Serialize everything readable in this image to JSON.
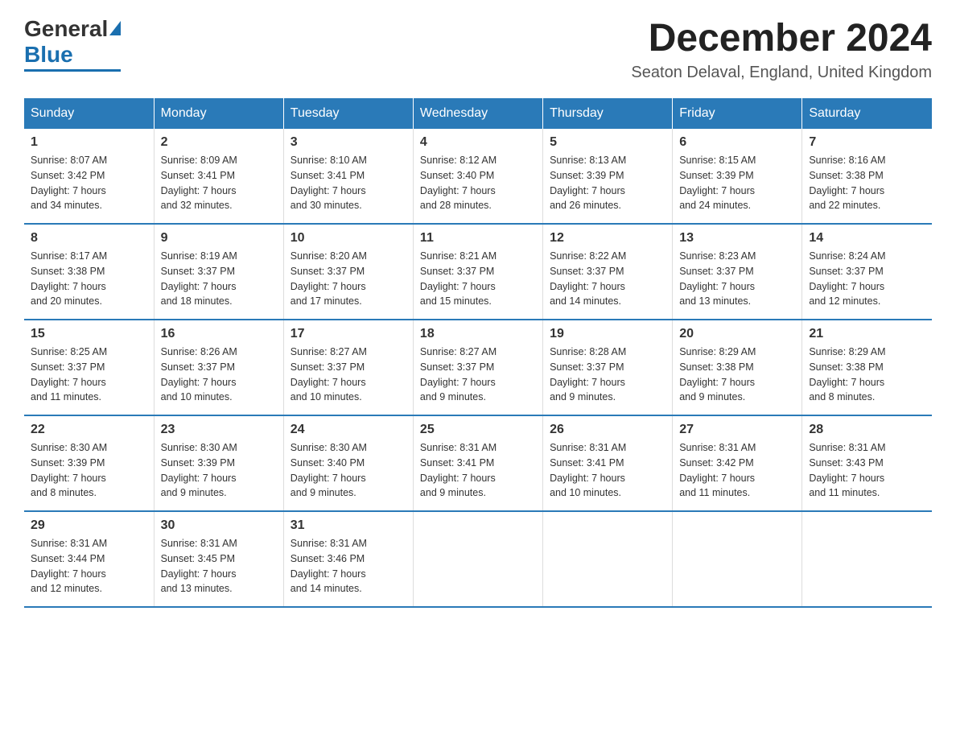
{
  "logo": {
    "general": "General",
    "blue": "Blue"
  },
  "header": {
    "month_title": "December 2024",
    "location": "Seaton Delaval, England, United Kingdom"
  },
  "weekdays": [
    "Sunday",
    "Monday",
    "Tuesday",
    "Wednesday",
    "Thursday",
    "Friday",
    "Saturday"
  ],
  "weeks": [
    [
      {
        "day": "1",
        "sunrise": "8:07 AM",
        "sunset": "3:42 PM",
        "daylight": "7 hours and 34 minutes."
      },
      {
        "day": "2",
        "sunrise": "8:09 AM",
        "sunset": "3:41 PM",
        "daylight": "7 hours and 32 minutes."
      },
      {
        "day": "3",
        "sunrise": "8:10 AM",
        "sunset": "3:41 PM",
        "daylight": "7 hours and 30 minutes."
      },
      {
        "day": "4",
        "sunrise": "8:12 AM",
        "sunset": "3:40 PM",
        "daylight": "7 hours and 28 minutes."
      },
      {
        "day": "5",
        "sunrise": "8:13 AM",
        "sunset": "3:39 PM",
        "daylight": "7 hours and 26 minutes."
      },
      {
        "day": "6",
        "sunrise": "8:15 AM",
        "sunset": "3:39 PM",
        "daylight": "7 hours and 24 minutes."
      },
      {
        "day": "7",
        "sunrise": "8:16 AM",
        "sunset": "3:38 PM",
        "daylight": "7 hours and 22 minutes."
      }
    ],
    [
      {
        "day": "8",
        "sunrise": "8:17 AM",
        "sunset": "3:38 PM",
        "daylight": "7 hours and 20 minutes."
      },
      {
        "day": "9",
        "sunrise": "8:19 AM",
        "sunset": "3:37 PM",
        "daylight": "7 hours and 18 minutes."
      },
      {
        "day": "10",
        "sunrise": "8:20 AM",
        "sunset": "3:37 PM",
        "daylight": "7 hours and 17 minutes."
      },
      {
        "day": "11",
        "sunrise": "8:21 AM",
        "sunset": "3:37 PM",
        "daylight": "7 hours and 15 minutes."
      },
      {
        "day": "12",
        "sunrise": "8:22 AM",
        "sunset": "3:37 PM",
        "daylight": "7 hours and 14 minutes."
      },
      {
        "day": "13",
        "sunrise": "8:23 AM",
        "sunset": "3:37 PM",
        "daylight": "7 hours and 13 minutes."
      },
      {
        "day": "14",
        "sunrise": "8:24 AM",
        "sunset": "3:37 PM",
        "daylight": "7 hours and 12 minutes."
      }
    ],
    [
      {
        "day": "15",
        "sunrise": "8:25 AM",
        "sunset": "3:37 PM",
        "daylight": "7 hours and 11 minutes."
      },
      {
        "day": "16",
        "sunrise": "8:26 AM",
        "sunset": "3:37 PM",
        "daylight": "7 hours and 10 minutes."
      },
      {
        "day": "17",
        "sunrise": "8:27 AM",
        "sunset": "3:37 PM",
        "daylight": "7 hours and 10 minutes."
      },
      {
        "day": "18",
        "sunrise": "8:27 AM",
        "sunset": "3:37 PM",
        "daylight": "7 hours and 9 minutes."
      },
      {
        "day": "19",
        "sunrise": "8:28 AM",
        "sunset": "3:37 PM",
        "daylight": "7 hours and 9 minutes."
      },
      {
        "day": "20",
        "sunrise": "8:29 AM",
        "sunset": "3:38 PM",
        "daylight": "7 hours and 9 minutes."
      },
      {
        "day": "21",
        "sunrise": "8:29 AM",
        "sunset": "3:38 PM",
        "daylight": "7 hours and 8 minutes."
      }
    ],
    [
      {
        "day": "22",
        "sunrise": "8:30 AM",
        "sunset": "3:39 PM",
        "daylight": "7 hours and 8 minutes."
      },
      {
        "day": "23",
        "sunrise": "8:30 AM",
        "sunset": "3:39 PM",
        "daylight": "7 hours and 9 minutes."
      },
      {
        "day": "24",
        "sunrise": "8:30 AM",
        "sunset": "3:40 PM",
        "daylight": "7 hours and 9 minutes."
      },
      {
        "day": "25",
        "sunrise": "8:31 AM",
        "sunset": "3:41 PM",
        "daylight": "7 hours and 9 minutes."
      },
      {
        "day": "26",
        "sunrise": "8:31 AM",
        "sunset": "3:41 PM",
        "daylight": "7 hours and 10 minutes."
      },
      {
        "day": "27",
        "sunrise": "8:31 AM",
        "sunset": "3:42 PM",
        "daylight": "7 hours and 11 minutes."
      },
      {
        "day": "28",
        "sunrise": "8:31 AM",
        "sunset": "3:43 PM",
        "daylight": "7 hours and 11 minutes."
      }
    ],
    [
      {
        "day": "29",
        "sunrise": "8:31 AM",
        "sunset": "3:44 PM",
        "daylight": "7 hours and 12 minutes."
      },
      {
        "day": "30",
        "sunrise": "8:31 AM",
        "sunset": "3:45 PM",
        "daylight": "7 hours and 13 minutes."
      },
      {
        "day": "31",
        "sunrise": "8:31 AM",
        "sunset": "3:46 PM",
        "daylight": "7 hours and 14 minutes."
      },
      null,
      null,
      null,
      null
    ]
  ],
  "labels": {
    "sunrise": "Sunrise:",
    "sunset": "Sunset:",
    "daylight": "Daylight:"
  }
}
